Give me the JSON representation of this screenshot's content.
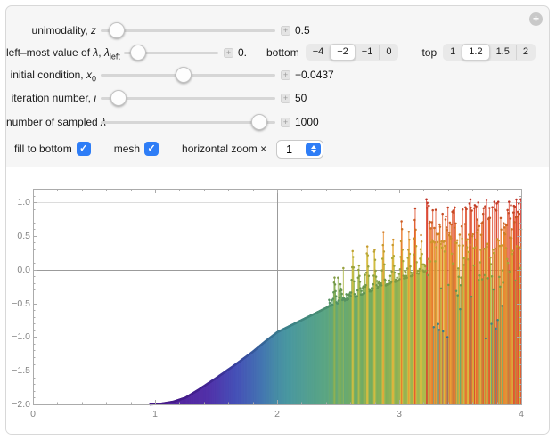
{
  "icons": {
    "check_glyph": "✓",
    "plus_glyph": "+",
    "expand_glyph": "+",
    "stepper_icon": "up-down-chevrons"
  },
  "controls": {
    "sliders": [
      {
        "pre": "unimodality, ",
        "v1": "z",
        "value": "0.5",
        "pos": 0.05
      },
      {
        "pre": "left–most value of ",
        "v1": "λ",
        "mid": ", ",
        "v2": "λ",
        "s2": "left",
        "value": "0.",
        "pos": 0.08
      },
      {
        "pre": "initial condition, ",
        "v1": "x",
        "s1": "0",
        "value": "−0.0437",
        "pos": 0.47
      },
      {
        "pre": "iteration number, ",
        "v1": "i",
        "value": "50",
        "pos": 0.06
      },
      {
        "pre": "number of sampled ",
        "v1": "λ",
        "value": "1000",
        "pos": 0.95
      }
    ],
    "range": {
      "bottom_label": "bottom",
      "bottom_options": [
        "−4",
        "−2",
        "−1",
        "0"
      ],
      "bottom_selected": 1,
      "top_label": "top",
      "top_options": [
        "1",
        "1.2",
        "1.5",
        "2"
      ],
      "top_selected": 1
    },
    "fill_label": "fill to bottom",
    "fill_checked": true,
    "mesh_label": "mesh",
    "mesh_checked": true,
    "zoom_label": "horizontal zoom ×",
    "zoom_value": "1"
  },
  "chart_data": {
    "type": "area",
    "description": "Final iterate x_i of a unimodal map after i=50 iterations vs lambda, 1000 sampled lambda, filled to bottom of plot, rainbow-colored by value, mesh dots at sample tops",
    "xlim": [
      0,
      4
    ],
    "ylim": [
      -2,
      1.2
    ],
    "x_tick_values": [
      0,
      1,
      2,
      3,
      4
    ],
    "x_tick_labels": [
      "0",
      "1",
      "2",
      "3",
      "4"
    ],
    "y_tick_values": [
      1.0,
      0.5,
      0.0,
      -0.5,
      -1.0,
      -1.5,
      -2.0
    ],
    "y_tick_labels": [
      "1.0",
      "0.5",
      "0.0",
      "−0.5",
      "−1.0",
      "−1.5",
      "−2.0"
    ],
    "gridlines_x": [
      2
    ],
    "gridlines_y": [
      0,
      1
    ],
    "n_samples": 1000,
    "fill_start": 0.96,
    "chaos_start": 2.42,
    "dense_start": 3.22,
    "envelope": [
      [
        0.96,
        -2.0
      ],
      [
        1.05,
        -1.99
      ],
      [
        1.15,
        -1.96
      ],
      [
        1.25,
        -1.9
      ],
      [
        1.35,
        -1.79
      ],
      [
        1.5,
        -1.61
      ],
      [
        1.65,
        -1.42
      ],
      [
        1.8,
        -1.22
      ],
      [
        1.9,
        -1.07
      ],
      [
        2.0,
        -0.93
      ],
      [
        2.1,
        -0.84
      ],
      [
        2.2,
        -0.75
      ],
      [
        2.3,
        -0.66
      ],
      [
        2.42,
        -0.55
      ],
      [
        2.6,
        -0.43
      ],
      [
        2.8,
        -0.3
      ],
      [
        3.0,
        -0.16
      ],
      [
        3.22,
        -0.02
      ]
    ],
    "spikes": [
      [
        2.47,
        -0.05
      ],
      [
        2.52,
        -0.18
      ],
      [
        2.62,
        0.36
      ],
      [
        2.67,
        0.1
      ],
      [
        2.74,
        0.42
      ],
      [
        2.8,
        0.34
      ],
      [
        2.87,
        0.6
      ],
      [
        2.95,
        0.52
      ],
      [
        3.02,
        0.82
      ],
      [
        3.08,
        0.62
      ],
      [
        3.13,
        1.0
      ],
      [
        3.18,
        0.58
      ]
    ],
    "colormap": [
      [
        0,
        "#4f1d9a"
      ],
      [
        0.1,
        "#4b2aa6"
      ],
      [
        0.2,
        "#3f4cb5"
      ],
      [
        0.3,
        "#3d74ad"
      ],
      [
        0.38,
        "#44959c"
      ],
      [
        0.48,
        "#58a47b"
      ],
      [
        0.56,
        "#73aa58"
      ],
      [
        0.64,
        "#9fb34a"
      ],
      [
        0.72,
        "#ccc13e"
      ],
      [
        0.8,
        "#eca52f"
      ],
      [
        0.88,
        "#e76e2a"
      ],
      [
        1,
        "#d8352a"
      ]
    ]
  }
}
